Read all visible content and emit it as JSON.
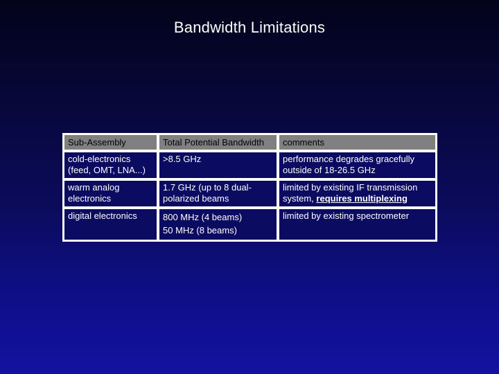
{
  "slide": {
    "title": "Bandwidth Limitations"
  },
  "table": {
    "headers": [
      "Sub-Assembly",
      "Total Potential Bandwidth",
      "comments"
    ],
    "rows": [
      {
        "sub_assembly": [
          "cold-electronics",
          "(feed, OMT, LNA...)"
        ],
        "bandwidth": [
          ">8.5 GHz"
        ],
        "comments": [
          "performance degrades gracefully",
          "outside of 18-26.5 GHz"
        ]
      },
      {
        "sub_assembly": [
          "warm analog",
          "electronics"
        ],
        "bandwidth": [
          "1.7 GHz (up to 8 dual-",
          "polarized beams"
        ],
        "comments": [
          "limited by existing IF transmission",
          "system, "
        ],
        "comments_emphasis": "requires multiplexing"
      },
      {
        "sub_assembly": [
          "digital electronics"
        ],
        "bandwidth": [
          "800 MHz (4 beams)",
          "50 MHz (8 beams)"
        ],
        "comments": [
          "limited by existing spectrometer"
        ]
      }
    ]
  },
  "colors": {
    "cell_bg": "#0b0b62",
    "header_bg": "#808080",
    "border": "#ffffff",
    "text": "#ffffff"
  }
}
